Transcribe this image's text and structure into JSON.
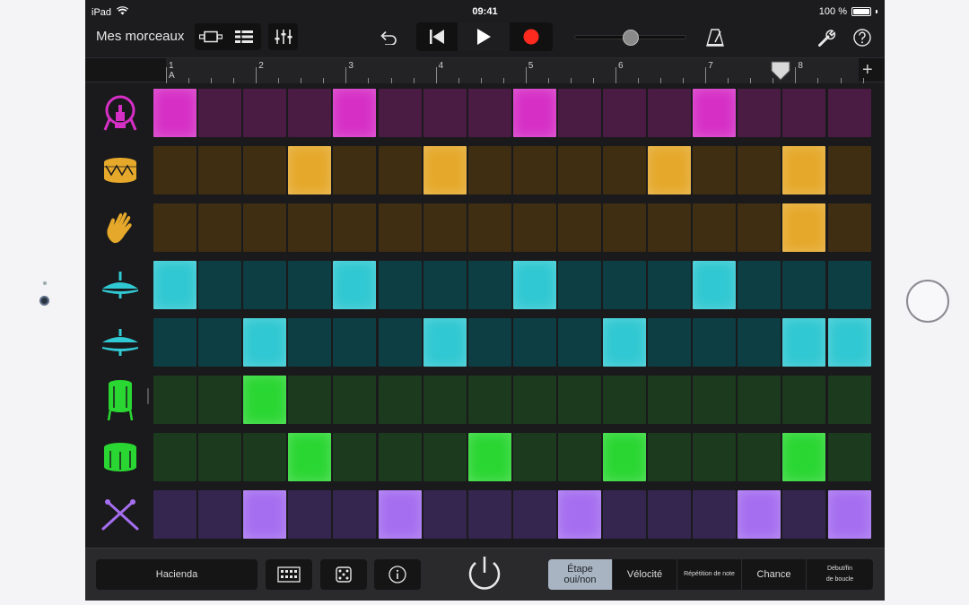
{
  "status": {
    "device": "iPad",
    "time": "09:41",
    "battery": "100 %"
  },
  "toolbar": {
    "title": "Mes morceaux",
    "icons": [
      "view-toggle-icon",
      "tracks-view-icon",
      "mixer-icon",
      "undo-icon",
      "rewind-icon",
      "play-icon",
      "record-icon",
      "metronome-icon",
      "settings-wrench-icon",
      "help-icon"
    ],
    "volume_level": 0.5
  },
  "ruler": {
    "bars": [
      "1",
      "2",
      "3",
      "4",
      "5",
      "6",
      "7",
      "8"
    ],
    "section_label": "A",
    "playhead_step": 16
  },
  "colors": {
    "kick": "#d62fc6",
    "kick_off": "#4a1c44",
    "snare": "#e5a82a",
    "snare_off": "#3f2e12",
    "clap": "#e5a82a",
    "clap_off": "#3f2e12",
    "hat1": "#30c8d2",
    "hat1_off": "#0c3e44",
    "hat2": "#30c8d2",
    "hat2_off": "#0c3e44",
    "tom1": "#2ad632",
    "tom1_off": "#1c3a1e",
    "tom2": "#2ad632",
    "tom2_off": "#1c3a1e",
    "sticks": "#a56ef0",
    "sticks_off": "#34264e"
  },
  "tracks": [
    {
      "name": "kick-drum",
      "icon": "kick-drum-icon",
      "color": "#d62fc6",
      "off": "#4a1c44",
      "steps": [
        1,
        0,
        0,
        0,
        1,
        0,
        0,
        0,
        1,
        0,
        0,
        0,
        1,
        0,
        0,
        0
      ]
    },
    {
      "name": "snare-drum",
      "icon": "snare-drum-icon",
      "color": "#e5a82a",
      "off": "#3f2e12",
      "steps": [
        0,
        0,
        0,
        1,
        0,
        0,
        1,
        0,
        0,
        0,
        0,
        1,
        0,
        0,
        1,
        0
      ]
    },
    {
      "name": "hand-clap",
      "icon": "hand-clap-icon",
      "color": "#e5a82a",
      "off": "#3f2e12",
      "steps": [
        0,
        0,
        0,
        0,
        0,
        0,
        0,
        0,
        0,
        0,
        0,
        0,
        0,
        0,
        1,
        0
      ]
    },
    {
      "name": "closed-hi-hat",
      "icon": "closed-hi-hat-icon",
      "color": "#30c8d2",
      "off": "#0c3e44",
      "steps": [
        1,
        0,
        0,
        0,
        1,
        0,
        0,
        0,
        1,
        0,
        0,
        0,
        1,
        0,
        0,
        0
      ]
    },
    {
      "name": "open-hi-hat",
      "icon": "open-hi-hat-icon",
      "color": "#30c8d2",
      "off": "#0c3e44",
      "steps": [
        0,
        0,
        1,
        0,
        0,
        0,
        1,
        0,
        0,
        0,
        1,
        0,
        0,
        0,
        1,
        1
      ]
    },
    {
      "name": "floor-tom",
      "icon": "floor-tom-icon",
      "color": "#2ad632",
      "off": "#1c3a1e",
      "steps": [
        0,
        0,
        1,
        0,
        0,
        0,
        0,
        0,
        0,
        0,
        0,
        0,
        0,
        0,
        0,
        0
      ]
    },
    {
      "name": "tom",
      "icon": "tom-icon",
      "color": "#2ad632",
      "off": "#1c3a1e",
      "steps": [
        0,
        0,
        0,
        1,
        0,
        0,
        0,
        1,
        0,
        0,
        1,
        0,
        0,
        0,
        1,
        0
      ]
    },
    {
      "name": "drum-sticks",
      "icon": "drum-sticks-icon",
      "color": "#a56ef0",
      "off": "#34264e",
      "steps": [
        0,
        0,
        1,
        0,
        0,
        1,
        0,
        0,
        0,
        1,
        0,
        0,
        0,
        1,
        0,
        1
      ]
    }
  ],
  "bottom": {
    "pattern_name": "Hacienda",
    "modes": [
      {
        "label": "Étape\noui/non",
        "active": true
      },
      {
        "label": "Vélocité",
        "active": false
      },
      {
        "label": "Répétition de note",
        "active": false
      },
      {
        "label": "Chance",
        "active": false
      },
      {
        "label": "Début/fin\nde boucle",
        "active": false
      }
    ]
  }
}
